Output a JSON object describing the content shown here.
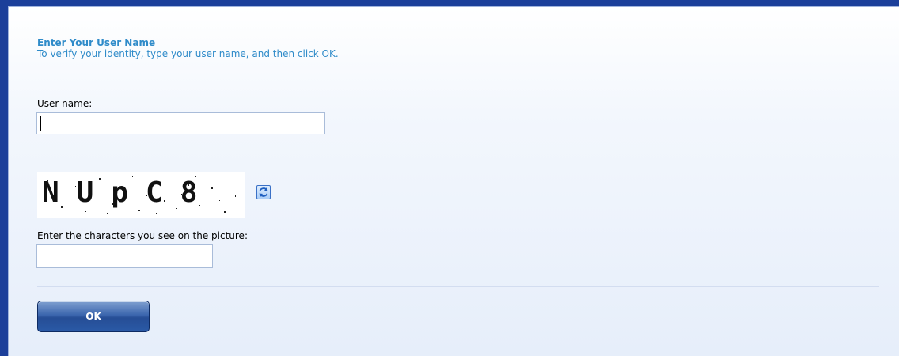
{
  "header": {
    "title": "Enter Your User Name",
    "subtitle": "To verify your identity, type your user name, and then click OK."
  },
  "username": {
    "label": "User name:",
    "value": ""
  },
  "captcha": {
    "image_text": "NUpC8",
    "refresh_icon": "refresh-icon",
    "label": "Enter the characters you see on the picture:",
    "value": ""
  },
  "actions": {
    "ok_label": "OK"
  },
  "colors": {
    "accent": "#2f8bc9",
    "background": "#1c3f9a",
    "button": "#2a5aa6"
  }
}
